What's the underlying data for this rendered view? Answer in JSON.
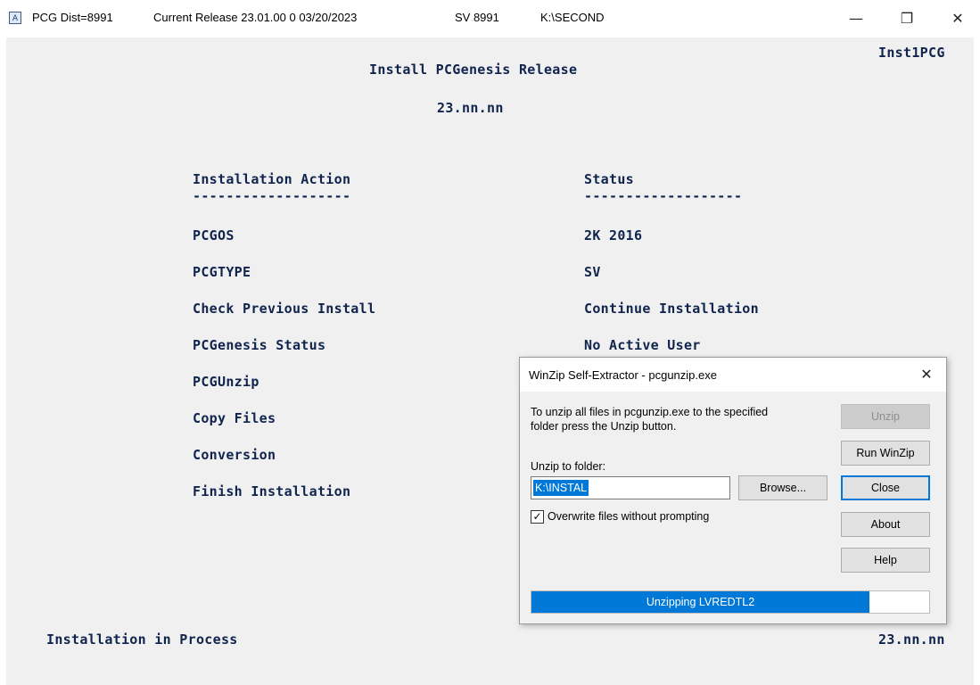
{
  "titlebar": {
    "app_icon": "A",
    "dist": "PCG Dist=8991",
    "release": "Current Release 23.01.00  0  03/20/2023",
    "sv": "SV  8991",
    "path": "K:\\SECOND",
    "minimize": "—",
    "restore": "❐",
    "close": "✕"
  },
  "console": {
    "program": "Inst1PCG",
    "heading": "Install PCGenesis Release",
    "version": "23.nn.nn",
    "col_action": "Installation Action",
    "col_status": "Status",
    "underline": "-------------------",
    "actions": [
      "PCGOS",
      "PCGTYPE",
      "Check Previous Install",
      "PCGenesis Status",
      "PCGUnzip",
      "Copy Files",
      "Conversion",
      "Finish Installation"
    ],
    "statuses": [
      "2K  2016",
      "SV",
      "Continue Installation",
      "No Active User"
    ],
    "footer_left": "Installation in Process",
    "footer_right": "23.nn.nn"
  },
  "dialog": {
    "title": "WinZip Self-Extractor - pcgunzip.exe",
    "close": "✕",
    "message_line1": "To unzip all files in pcgunzip.exe to the specified",
    "message_line2": "folder press the Unzip button.",
    "folder_label": "Unzip to folder:",
    "folder_value": "K:\\INSTAL",
    "browse": "Browse...",
    "overwrite_label": "Overwrite files without prompting",
    "overwrite_checked": true,
    "buttons": {
      "unzip": "Unzip",
      "run_winzip": "Run WinZip",
      "close": "Close",
      "about": "About",
      "help": "Help"
    },
    "progress_text": "Unzipping LVREDTL2",
    "progress_fraction": 0.85
  }
}
